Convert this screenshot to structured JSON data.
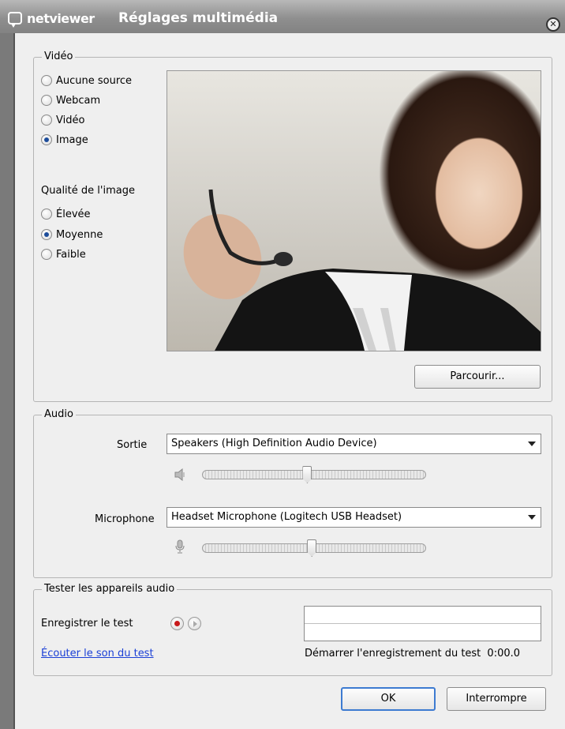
{
  "titlebar": {
    "logo_text": "netviewer",
    "title": "Réglages multimédia",
    "close_glyph": "✕"
  },
  "video": {
    "legend": "Vidéo",
    "sources": [
      {
        "label": "Aucune source",
        "checked": false
      },
      {
        "label": "Webcam",
        "checked": false
      },
      {
        "label": "Vidéo",
        "checked": false
      },
      {
        "label": "Image",
        "checked": true
      }
    ],
    "quality_label": "Qualité de l'image",
    "qualities": [
      {
        "label": "Élevée",
        "checked": false
      },
      {
        "label": "Moyenne",
        "checked": true
      },
      {
        "label": "Faible",
        "checked": false
      }
    ],
    "browse_label": "Parcourir..."
  },
  "audio": {
    "legend": "Audio",
    "output_label": "Sortie",
    "output_value": "Speakers (High Definition Audio Device)",
    "output_volume": 0.47,
    "mic_label": "Microphone",
    "mic_value": "Headset Microphone (Logitech USB Headset)",
    "mic_volume": 0.49
  },
  "test": {
    "legend": "Tester les appareils audio",
    "record_label": "Enregistrer le test",
    "listen_link": "Écouter le son du test",
    "status_text": "Démarrer l'enregistrement du test",
    "time": "0:00.0"
  },
  "footer": {
    "ok_label": "OK",
    "cancel_label": "Interrompre"
  },
  "colors": {
    "accent": "#3d7bd1",
    "link": "#1a3fd6",
    "record": "#c8191b"
  }
}
